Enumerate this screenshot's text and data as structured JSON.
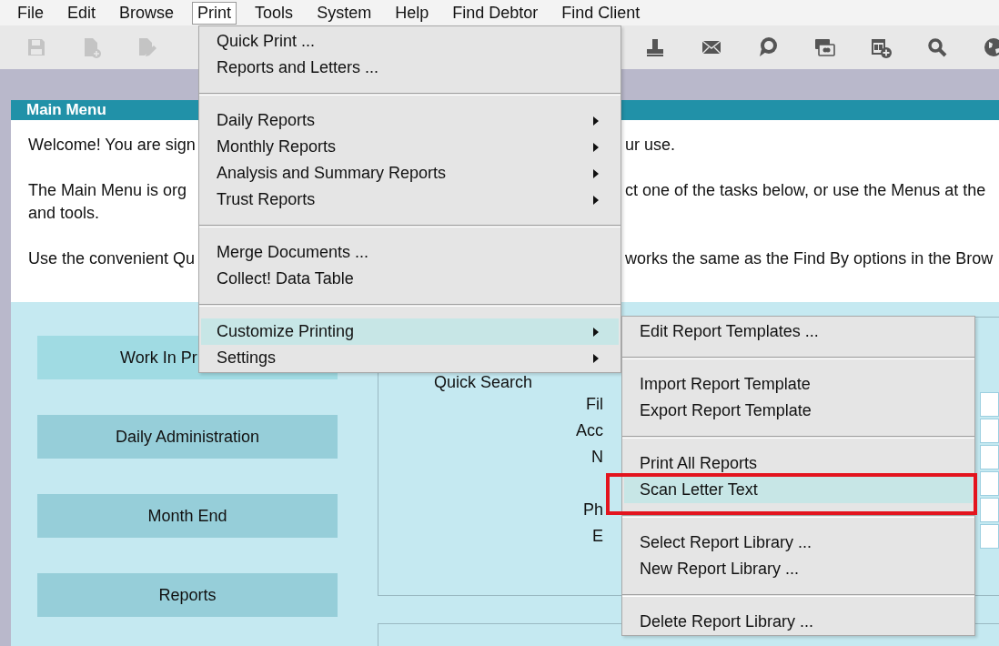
{
  "menubar": [
    {
      "label": "File",
      "selected": false
    },
    {
      "label": "Edit",
      "selected": false
    },
    {
      "label": "Browse",
      "selected": false
    },
    {
      "label": "Print",
      "selected": true
    },
    {
      "label": "Tools",
      "selected": false
    },
    {
      "label": "System",
      "selected": false
    },
    {
      "label": "Help",
      "selected": false
    },
    {
      "label": "Find Debtor",
      "selected": false
    },
    {
      "label": "Find Client",
      "selected": false
    }
  ],
  "toolbar": {
    "left": [
      {
        "kind": "save",
        "disabled": true
      },
      {
        "kind": "new-document",
        "disabled": true
      },
      {
        "kind": "edit-document",
        "disabled": true
      }
    ],
    "right": [
      {
        "kind": "print",
        "disabled": false
      },
      {
        "kind": "mail",
        "disabled": false
      },
      {
        "kind": "chat",
        "disabled": false
      },
      {
        "kind": "card",
        "disabled": false
      },
      {
        "kind": "calendar",
        "disabled": false
      },
      {
        "kind": "search",
        "disabled": false
      },
      {
        "kind": "globe",
        "disabled": false
      }
    ]
  },
  "main_menu": {
    "title": "Main Menu",
    "paragraphs": [
      {
        "lines": [
          {
            "left": "Welcome! You are sign",
            "right": "ur use."
          }
        ]
      },
      {
        "lines": [
          {
            "left": "The Main Menu is org",
            "right": "ct one of the tasks below, or use the Menus at the"
          },
          {
            "left": "and tools."
          }
        ]
      },
      {
        "lines": [
          {
            "left": "Use the convenient Qu",
            "right": "works the same as the Find By options in the Brow"
          }
        ]
      }
    ],
    "tasks": [
      {
        "label": "Work In Pr",
        "selected": true
      },
      {
        "label": "Daily Administration",
        "selected": false
      },
      {
        "label": "Month End",
        "selected": false
      },
      {
        "label": "Reports",
        "selected": false
      }
    ],
    "quick_search": {
      "title": "Quick Search",
      "rows": [
        {
          "kind": "labeled",
          "label": "Fil"
        },
        {
          "kind": "labeled",
          "label": "Acc"
        },
        {
          "kind": "labeled",
          "label": "N"
        },
        {
          "kind": "unlabeled"
        },
        {
          "kind": "labeled",
          "label": "Ph"
        },
        {
          "kind": "labeled",
          "label": "E"
        }
      ]
    }
  },
  "print_menu": {
    "items": [
      {
        "kind": "item",
        "label": "Quick Print ...",
        "submenu": false,
        "selected": false
      },
      {
        "kind": "item",
        "label": "Reports and Letters ...",
        "submenu": false,
        "selected": false
      },
      {
        "kind": "separator"
      },
      {
        "kind": "item",
        "label": "Daily Reports",
        "submenu": true,
        "selected": false
      },
      {
        "kind": "item",
        "label": "Monthly Reports",
        "submenu": true,
        "selected": false
      },
      {
        "kind": "item",
        "label": "Analysis and Summary Reports",
        "submenu": true,
        "selected": false
      },
      {
        "kind": "item",
        "label": "Trust Reports",
        "submenu": true,
        "selected": false
      },
      {
        "kind": "separator"
      },
      {
        "kind": "item",
        "label": "Merge Documents ...",
        "submenu": false,
        "selected": false
      },
      {
        "kind": "item",
        "label": "Collect! Data Table",
        "submenu": false,
        "selected": false
      },
      {
        "kind": "separator"
      },
      {
        "kind": "item",
        "label": "Customize Printing",
        "submenu": true,
        "selected": true
      },
      {
        "kind": "item",
        "label": "Settings",
        "submenu": true,
        "selected": false
      }
    ]
  },
  "customize_submenu": {
    "items": [
      {
        "kind": "item",
        "label": "Edit Report Templates ...",
        "selected": false
      },
      {
        "kind": "separator"
      },
      {
        "kind": "item",
        "label": "Import Report Template",
        "selected": false
      },
      {
        "kind": "item",
        "label": "Export Report Template",
        "selected": false
      },
      {
        "kind": "separator"
      },
      {
        "kind": "item",
        "label": "Print All Reports",
        "selected": false
      },
      {
        "kind": "item",
        "label": "Scan Letter Text",
        "selected": true
      },
      {
        "kind": "separator"
      },
      {
        "kind": "item",
        "label": "Select Report Library ...",
        "selected": false
      },
      {
        "kind": "item",
        "label": "New Report Library ...",
        "selected": false
      },
      {
        "kind": "separator"
      },
      {
        "kind": "item",
        "label": "Delete Report Library ...",
        "selected": false
      }
    ]
  }
}
